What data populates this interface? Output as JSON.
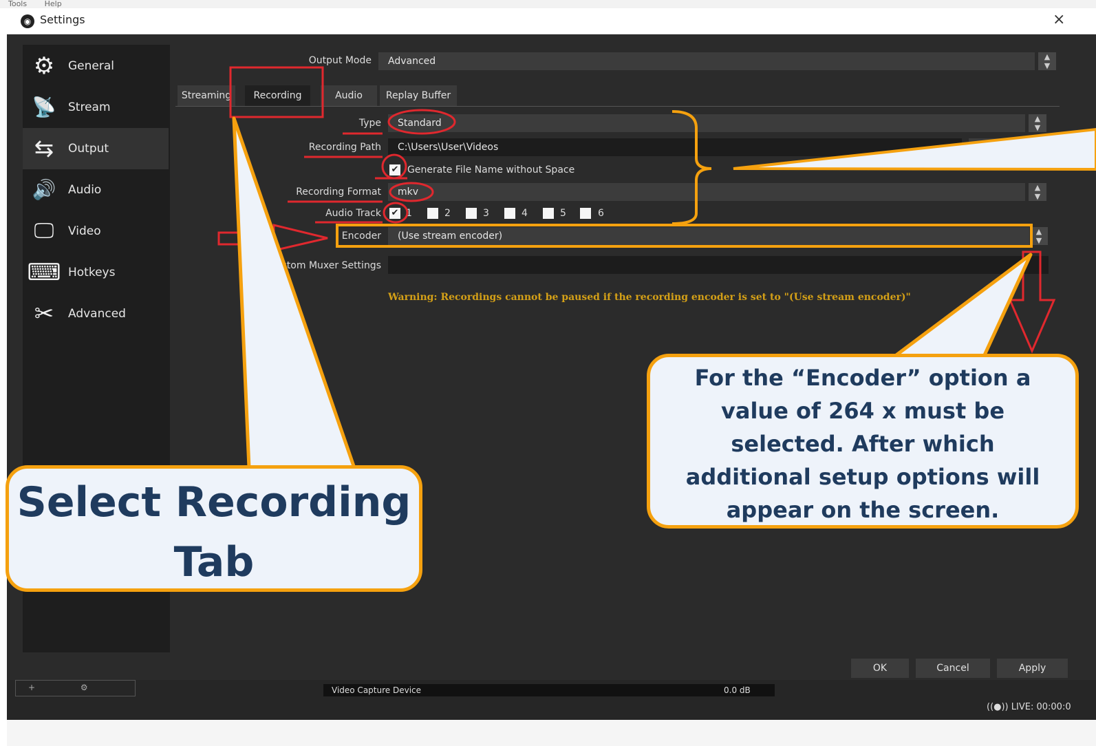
{
  "menubar": {
    "items": [
      "Tools",
      "Help"
    ]
  },
  "window": {
    "title": "Settings",
    "close": "×",
    "logo": "◉"
  },
  "sidebar": {
    "items": [
      {
        "label": "General",
        "icon": "⚙"
      },
      {
        "label": "Stream",
        "icon": "📡"
      },
      {
        "label": "Output",
        "icon": "⇆"
      },
      {
        "label": "Audio",
        "icon": "🔊"
      },
      {
        "label": "Video",
        "icon": "🖵"
      },
      {
        "label": "Hotkeys",
        "icon": "⌨"
      },
      {
        "label": "Advanced",
        "icon": "✂"
      }
    ],
    "active": "Output"
  },
  "output_mode": {
    "label": "Output Mode",
    "value": "Advanced"
  },
  "tabs": [
    "Streaming",
    "Recording",
    "Audio",
    "Replay Buffer"
  ],
  "selected_tab": "Recording",
  "recording": {
    "type_label": "Type",
    "type_value": "Standard",
    "path_label": "Recording Path",
    "path_value": "C:\\Users\\User\\Videos",
    "no_space_checkbox": "Generate File Name without Space",
    "format_label": "Recording Format",
    "format_value": "mkv",
    "audio_track_label": "Audio Track",
    "tracks": [
      "1",
      "2",
      "3",
      "4",
      "5",
      "6"
    ],
    "encoder_label": "Encoder",
    "encoder_value": "(Use stream encoder)",
    "muxer_label": "Custom Muxer Settings",
    "muxer_value": "",
    "warning": "Warning: Recordings cannot be paused if the recording encoder is set to \"(Use stream encoder)\""
  },
  "buttons": {
    "ok": "OK",
    "cancel": "Cancel",
    "apply": "Apply"
  },
  "background_ui": {
    "source": "Video Capture Device",
    "level": "0.0 dB",
    "live": "LIVE: 00:00:0",
    "dock_plus": "+",
    "dock_gear": "⚙"
  },
  "callouts": {
    "recording_tab": "Select Recording Tab",
    "encoder": "For the “Encoder” option a value of 264 x must be selected. After which additional setup options will appear on the screen."
  },
  "colors": {
    "callout_border": "#f5a10f",
    "callout_fill": "#eef3fa",
    "callout_text": "#1f3b5e",
    "annotation_red": "#e0282e",
    "warning": "#d4a017"
  }
}
